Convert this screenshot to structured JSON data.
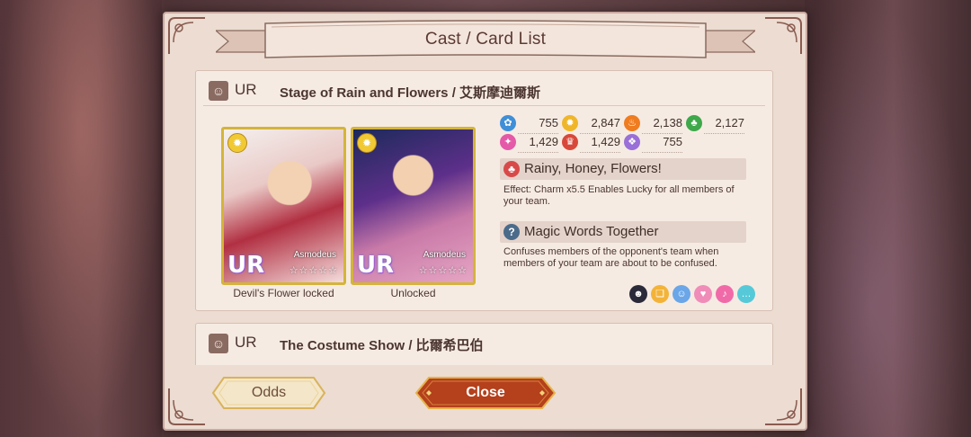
{
  "window": {
    "title": "Cast / Card List"
  },
  "cards": [
    {
      "rarity": "UR",
      "title": "Stage of Rain and Flowers / 艾斯摩迪爾斯",
      "variants": [
        {
          "character": "Asmodeus",
          "rarity_mark": "UR",
          "stars": "☆☆☆☆☆",
          "caption": "Devil's Flower locked"
        },
        {
          "character": "Asmodeus",
          "rarity_mark": "UR",
          "stars": "☆☆☆☆☆",
          "caption": "Unlocked"
        }
      ],
      "stats": [
        {
          "icon": "blue-flower-icon",
          "color": "#3f8fd8",
          "value": "755"
        },
        {
          "icon": "yellow-sun-icon",
          "color": "#f0b62a",
          "value": "2,847"
        },
        {
          "icon": "orange-flame-icon",
          "color": "#ef7c1f",
          "value": "2,138"
        },
        {
          "icon": "green-leaf-icon",
          "color": "#3ea84a",
          "value": "2,127"
        },
        {
          "icon": "pink-sparkle-icon",
          "color": "#e459a8",
          "value": "1,429"
        },
        {
          "icon": "red-crest-icon",
          "color": "#d8483a",
          "value": "1,429"
        },
        {
          "icon": "purple-crystal-icon",
          "color": "#9a6fd8",
          "value": "755"
        }
      ],
      "skills": [
        {
          "name": "Rainy, Honey, Flowers!",
          "icon": "clover-icon",
          "icon_color": "#d84a4a",
          "description": "Effect: Charm x5.5 Enables Lucky for all members of your team."
        },
        {
          "name": "Magic Words Together",
          "icon": "question-icon",
          "icon_color": "#4b6b8a",
          "description": "Confuses members of the opponent's team when members of your team are about to be confused."
        }
      ],
      "source_icons": [
        {
          "name": "demon-cat-icon",
          "color": "#2a2a3a"
        },
        {
          "name": "gift-icon",
          "color": "#f3b338"
        },
        {
          "name": "blue-person-icon",
          "color": "#6aa6e8"
        },
        {
          "name": "pink-shirt-icon",
          "color": "#f08cb8"
        },
        {
          "name": "pink-mic-icon",
          "color": "#f06aa8"
        },
        {
          "name": "chat-icon",
          "color": "#56c9d8"
        }
      ]
    },
    {
      "rarity": "UR",
      "title": "The Costume Show / 比爾希巴伯"
    }
  ],
  "buttons": {
    "odds": "Odds",
    "close": "Close"
  }
}
